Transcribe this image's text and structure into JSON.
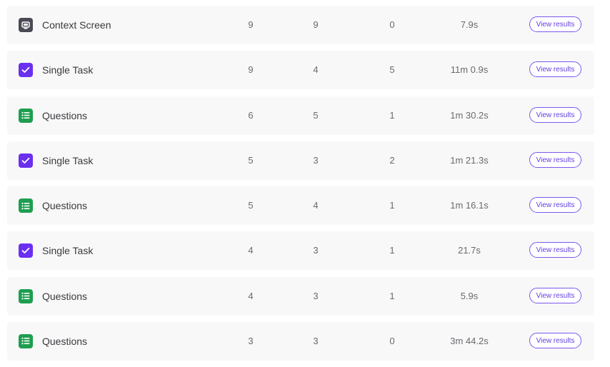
{
  "colors": {
    "context_icon": "#4a4a55",
    "task_icon": "#6b2ff0",
    "questions_icon": "#1e9e50",
    "button_accent": "#7b58ee",
    "row_bg": "#f8f8f8"
  },
  "rows": [
    {
      "icon": "monitor-icon",
      "name": "Context Screen",
      "col1": "9",
      "col2": "9",
      "col3": "0",
      "time": "7.9s",
      "action": "View results"
    },
    {
      "icon": "checkbox-icon",
      "name": "Single Task",
      "col1": "9",
      "col2": "4",
      "col3": "5",
      "time": "11m 0.9s",
      "action": "View results"
    },
    {
      "icon": "list-icon",
      "name": "Questions",
      "col1": "6",
      "col2": "5",
      "col3": "1",
      "time": "1m 30.2s",
      "action": "View results"
    },
    {
      "icon": "checkbox-icon",
      "name": "Single Task",
      "col1": "5",
      "col2": "3",
      "col3": "2",
      "time": "1m 21.3s",
      "action": "View results"
    },
    {
      "icon": "list-icon",
      "name": "Questions",
      "col1": "5",
      "col2": "4",
      "col3": "1",
      "time": "1m 16.1s",
      "action": "View results"
    },
    {
      "icon": "checkbox-icon",
      "name": "Single Task",
      "col1": "4",
      "col2": "3",
      "col3": "1",
      "time": "21.7s",
      "action": "View results"
    },
    {
      "icon": "list-icon",
      "name": "Questions",
      "col1": "4",
      "col2": "3",
      "col3": "1",
      "time": "5.9s",
      "action": "View results"
    },
    {
      "icon": "list-icon",
      "name": "Questions",
      "col1": "3",
      "col2": "3",
      "col3": "0",
      "time": "3m 44.2s",
      "action": "View results"
    }
  ]
}
